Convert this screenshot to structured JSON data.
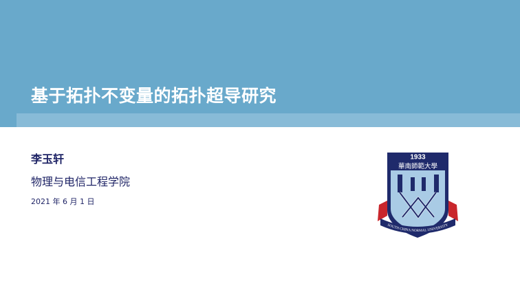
{
  "slide": {
    "title": "基于拓扑不变量的拓扑超导研究",
    "author": "李玉轩",
    "school": "物理与电信工程学院",
    "date": "2021 年 6 月 1 日"
  },
  "emblem": {
    "icon": "university-emblem-icon",
    "year": "1933",
    "name_cn": "華南師範大學",
    "name_en": "SOUTH CHINA NORMAL UNIVERSITY"
  },
  "colors": {
    "header_band": "#69a9cb",
    "header_stripe": "#88bbd7",
    "title_text": "#ffffff",
    "body_text": "#1f2466",
    "emblem_navy": "#1f2a6b",
    "emblem_light_blue": "#a9cbe5",
    "emblem_red": "#c9262c"
  }
}
